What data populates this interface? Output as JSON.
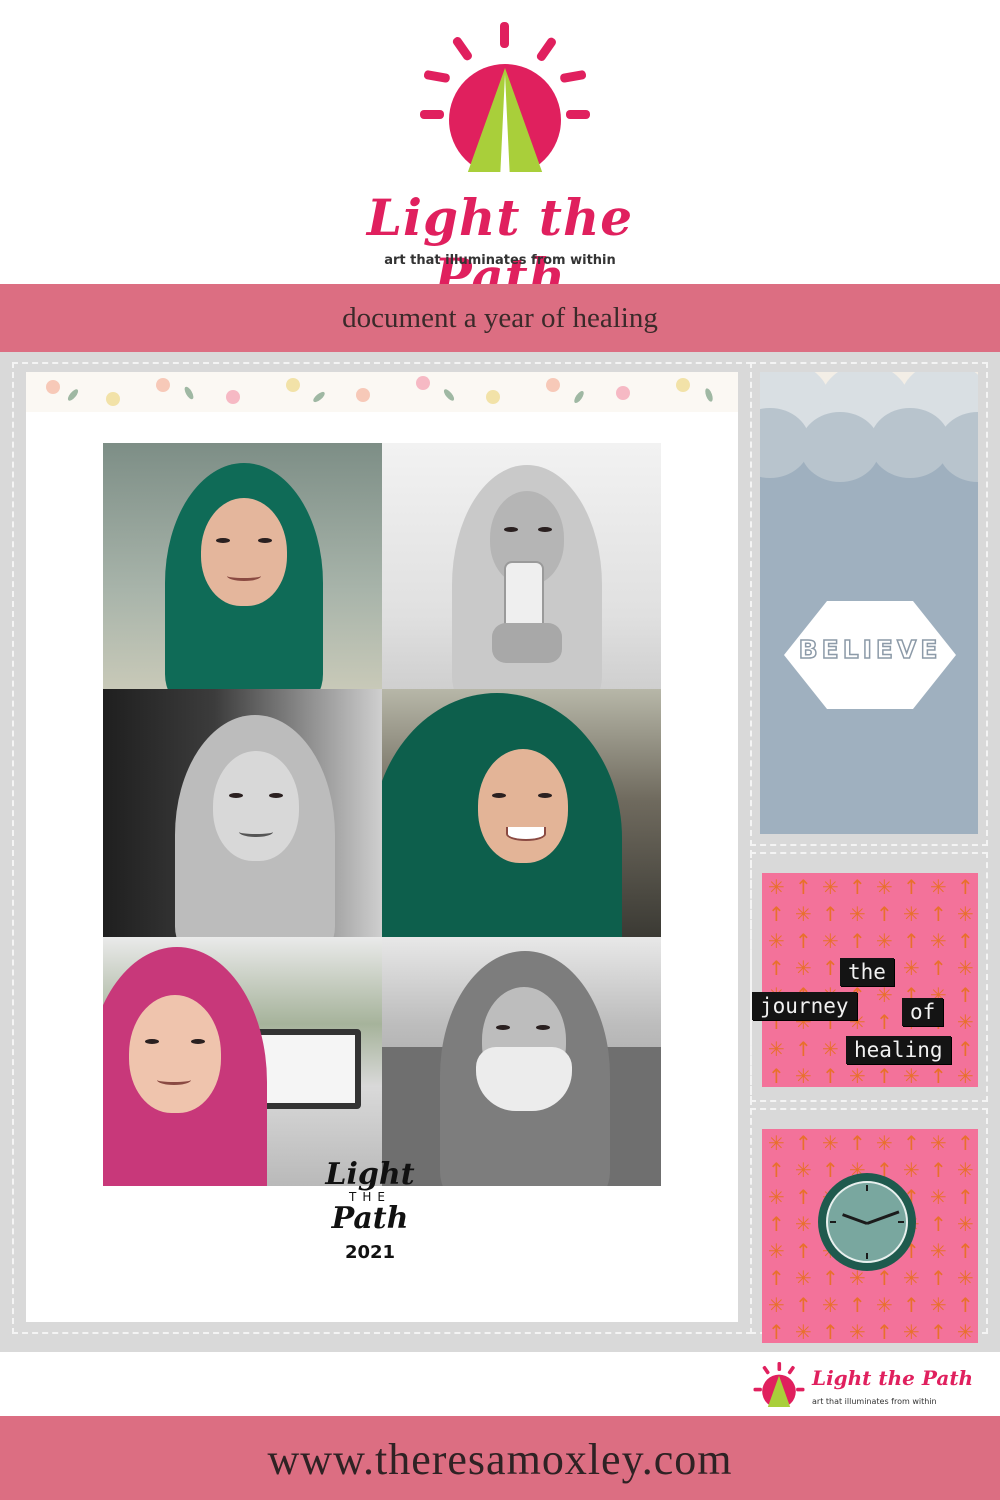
{
  "brand": {
    "title": "Light the Path",
    "tagline": "art that illuminates from within",
    "colors": {
      "pink": "#e0205e",
      "green": "#a9cf3a",
      "band": "#dc6e82"
    }
  },
  "subtitle": "document a year of healing",
  "layout": {
    "stamp": {
      "line1": "Light",
      "line2": "THE",
      "line3": "Path",
      "year": "2021"
    },
    "believe": "BELIEVE",
    "labels": [
      "the",
      "journey",
      "of",
      "healing"
    ],
    "photos": [
      {
        "tone": "color",
        "scarf": "#0f6b57"
      },
      {
        "tone": "bw",
        "scarf": "#cfcfcf"
      },
      {
        "tone": "bw",
        "scarf": "#bdbdbd"
      },
      {
        "tone": "color",
        "scarf": "#0d5f4c"
      },
      {
        "tone": "color",
        "scarf": "#c8387a"
      },
      {
        "tone": "bw",
        "scarf": "#7d7d7d"
      }
    ]
  },
  "footer": {
    "mini_title": "Light the Path",
    "mini_tag": "art that illuminates from within",
    "url": "www.theresamoxley.com"
  }
}
